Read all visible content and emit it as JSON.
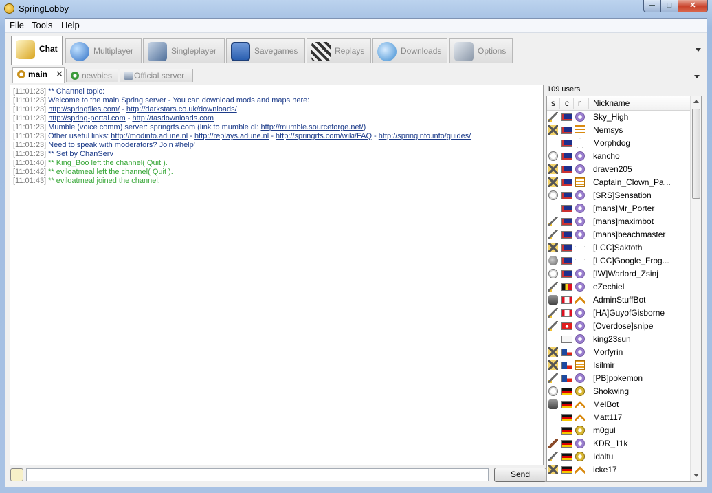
{
  "window": {
    "title": "SpringLobby",
    "min_icon": "minimize-icon",
    "max_icon": "maximize-icon",
    "close_icon": "close-icon"
  },
  "menubar": {
    "items": [
      "File",
      "Tools",
      "Help"
    ]
  },
  "main_tabs": [
    {
      "label": "Chat",
      "icon": "chat-icon",
      "color": "#d9a520"
    },
    {
      "label": "Multiplayer",
      "icon": "globe-icon",
      "color": "#2f6fc4"
    },
    {
      "label": "Singleplayer",
      "icon": "player-icon",
      "color": "#4f6f9a"
    },
    {
      "label": "Savegames",
      "icon": "floppy-disk-icon",
      "color": "#2a5fb0"
    },
    {
      "label": "Replays",
      "icon": "clapperboard-icon",
      "color": "#333333"
    },
    {
      "label": "Downloads",
      "icon": "download-globe-icon",
      "color": "#3a8ad0"
    },
    {
      "label": "Options",
      "icon": "tools-icon",
      "color": "#8a97a8"
    }
  ],
  "chat_tabs": [
    {
      "label": "main",
      "icon": "channel-icon"
    },
    {
      "label": "newbies",
      "icon": "channel-icon"
    },
    {
      "label": "Official server",
      "icon": "server-icon"
    }
  ],
  "chat_lines": [
    {
      "time": "[11:01:23]",
      "segments": [
        {
          "t": " ** Channel topic:",
          "c": "blue"
        }
      ]
    },
    {
      "time": "[11:01:23]",
      "segments": [
        {
          "t": " Welcome to the main Spring server - You can download mods and maps here:",
          "c": "blue"
        }
      ]
    },
    {
      "time": "[11:01:23]",
      "segments": [
        {
          "t": "  ",
          "c": "blue"
        },
        {
          "t": "http://springfiles.com/",
          "c": "lnk"
        },
        {
          "t": " - ",
          "c": "blue"
        },
        {
          "t": "http://darkstars.co.uk/downloads/",
          "c": "lnk"
        }
      ]
    },
    {
      "time": "[11:01:23]",
      "segments": [
        {
          "t": "  ",
          "c": "blue"
        },
        {
          "t": "http://spring-portal.com",
          "c": "lnk"
        },
        {
          "t": " - ",
          "c": "blue"
        },
        {
          "t": "http://tasdownloads.com",
          "c": "lnk"
        }
      ]
    },
    {
      "time": "[11:01:23]",
      "segments": [
        {
          "t": "  Mumble (voice comm) server: springrts.com (link to mumble dl: ",
          "c": "blue"
        },
        {
          "t": "http://mumble.sourceforge.net/",
          "c": "lnk"
        },
        {
          "t": ")",
          "c": "blue"
        }
      ]
    },
    {
      "time": "[11:01:23]",
      "segments": [
        {
          "t": "  Other useful links: ",
          "c": "blue"
        },
        {
          "t": "http://modinfo.adune.nl",
          "c": "lnk"
        },
        {
          "t": " - ",
          "c": "blue"
        },
        {
          "t": "http://replays.adune.nl",
          "c": "lnk"
        },
        {
          "t": " - ",
          "c": "blue"
        },
        {
          "t": "http://springrts.com/wiki/FAQ",
          "c": "lnk"
        },
        {
          "t": " - ",
          "c": "blue"
        },
        {
          "t": "http://springinfo.info/guides/",
          "c": "lnk"
        }
      ]
    },
    {
      "time": "[11:01:23]",
      "segments": [
        {
          "t": "  Need to speak with moderators? Join #help'",
          "c": "blue"
        }
      ]
    },
    {
      "time": "[11:01:23]",
      "segments": [
        {
          "t": " ** Set by ChanServ",
          "c": "blue"
        }
      ]
    },
    {
      "time": "[11:01:40]",
      "segments": [
        {
          "t": " ** King_Boo left the channel( Quit ).",
          "c": "green"
        }
      ]
    },
    {
      "time": "[11:01:42]",
      "segments": [
        {
          "t": " ** eviloatmeal left the channel( Quit ).",
          "c": "green"
        }
      ]
    },
    {
      "time": "[11:01:43]",
      "segments": [
        {
          "t": " ** eviloatmeal joined the channel.",
          "c": "green"
        }
      ]
    }
  ],
  "input": {
    "send_label": "Send",
    "value": "",
    "icon": "smiley-icon"
  },
  "userlist": {
    "count_label": "109 users",
    "headers": {
      "s": "s",
      "c": "c",
      "r": "r",
      "name": "Nickname"
    },
    "users": [
      {
        "name": "Sky_High",
        "status": "sword",
        "flag": "AU",
        "rank": "medal"
      },
      {
        "name": "Nemsys",
        "status": "crossed-swords",
        "flag": "AU",
        "rank": "chevron-double"
      },
      {
        "name": "Morphdog",
        "status": "",
        "flag": "AU",
        "rank": "star"
      },
      {
        "name": "kancho",
        "status": "clock",
        "flag": "AU",
        "rank": "medal"
      },
      {
        "name": "draven205",
        "status": "crossed-swords",
        "flag": "AU",
        "rank": "medal"
      },
      {
        "name": "Captain_Clown_Pa...",
        "status": "crossed-swords",
        "flag": "AU",
        "rank": "chevron-triple"
      },
      {
        "name": "[SRS]Sensation",
        "status": "clock",
        "flag": "AU",
        "rank": "medal"
      },
      {
        "name": "[mans]Mr_Porter",
        "status": "",
        "flag": "AU",
        "rank": "medal"
      },
      {
        "name": "[mans]maximbot",
        "status": "sword",
        "flag": "AU",
        "rank": "medal"
      },
      {
        "name": "[mans]beachmaster",
        "status": "sword",
        "flag": "AU",
        "rank": "medal"
      },
      {
        "name": "[LCC]Saktoth",
        "status": "crossed-swords",
        "flag": "AU",
        "rank": "star"
      },
      {
        "name": "[LCC]Google_Frog...",
        "status": "ball",
        "flag": "AU",
        "rank": "star"
      },
      {
        "name": "[IW]Warlord_Zsinj",
        "status": "clock",
        "flag": "AU",
        "rank": "medal"
      },
      {
        "name": "eZechiel",
        "status": "sword",
        "flag": "BE",
        "rank": "medal"
      },
      {
        "name": "AdminStuffBot",
        "status": "robot",
        "flag": "CA",
        "rank": "chevron"
      },
      {
        "name": "[HA]GuyofGisborne",
        "status": "sword",
        "flag": "CA",
        "rank": "medal"
      },
      {
        "name": "[Overdose]snipe",
        "status": "sword",
        "flag": "CH",
        "rank": "medal"
      },
      {
        "name": "king23sun",
        "status": "",
        "flag": "CN",
        "rank": "medal"
      },
      {
        "name": "Morfyrin",
        "status": "crossed-swords",
        "flag": "CZ",
        "rank": "medal"
      },
      {
        "name": "Isilmir",
        "status": "crossed-swords",
        "flag": "CZ",
        "rank": "chevron-triple"
      },
      {
        "name": "[PB]pokemon",
        "status": "sword",
        "flag": "CZ",
        "rank": "medal"
      },
      {
        "name": "Shokwing",
        "status": "clock",
        "flag": "DE",
        "rank": "medal-gold"
      },
      {
        "name": "MelBot",
        "status": "robot",
        "flag": "DE",
        "rank": "chevron"
      },
      {
        "name": "Matt117",
        "status": "",
        "flag": "DE",
        "rank": "chevron"
      },
      {
        "name": "m0gul",
        "status": "",
        "flag": "DE",
        "rank": "medal-gold"
      },
      {
        "name": "KDR_11k",
        "status": "wrench",
        "flag": "DE",
        "rank": "medal"
      },
      {
        "name": "Idaltu",
        "status": "sword",
        "flag": "DE",
        "rank": "medal-gold"
      },
      {
        "name": "icke17",
        "status": "crossed-swords",
        "flag": "DE",
        "rank": "chevron"
      }
    ]
  }
}
